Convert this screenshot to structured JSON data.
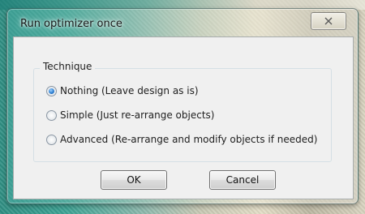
{
  "window": {
    "title": "Run optimizer once",
    "close_icon": "close-icon"
  },
  "technique": {
    "label": "Technique",
    "options": [
      {
        "label": "Nothing (Leave design as is)",
        "selected": true
      },
      {
        "label": "Simple (Just re-arrange objects)",
        "selected": false
      },
      {
        "label": "Advanced (Re-arrange and modify objects if needed)",
        "selected": false
      }
    ]
  },
  "buttons": {
    "ok_label": "OK",
    "cancel_label": "Cancel"
  },
  "colors": {
    "accent": "#2f7fd1",
    "client_bg": "#f0f0f0"
  }
}
